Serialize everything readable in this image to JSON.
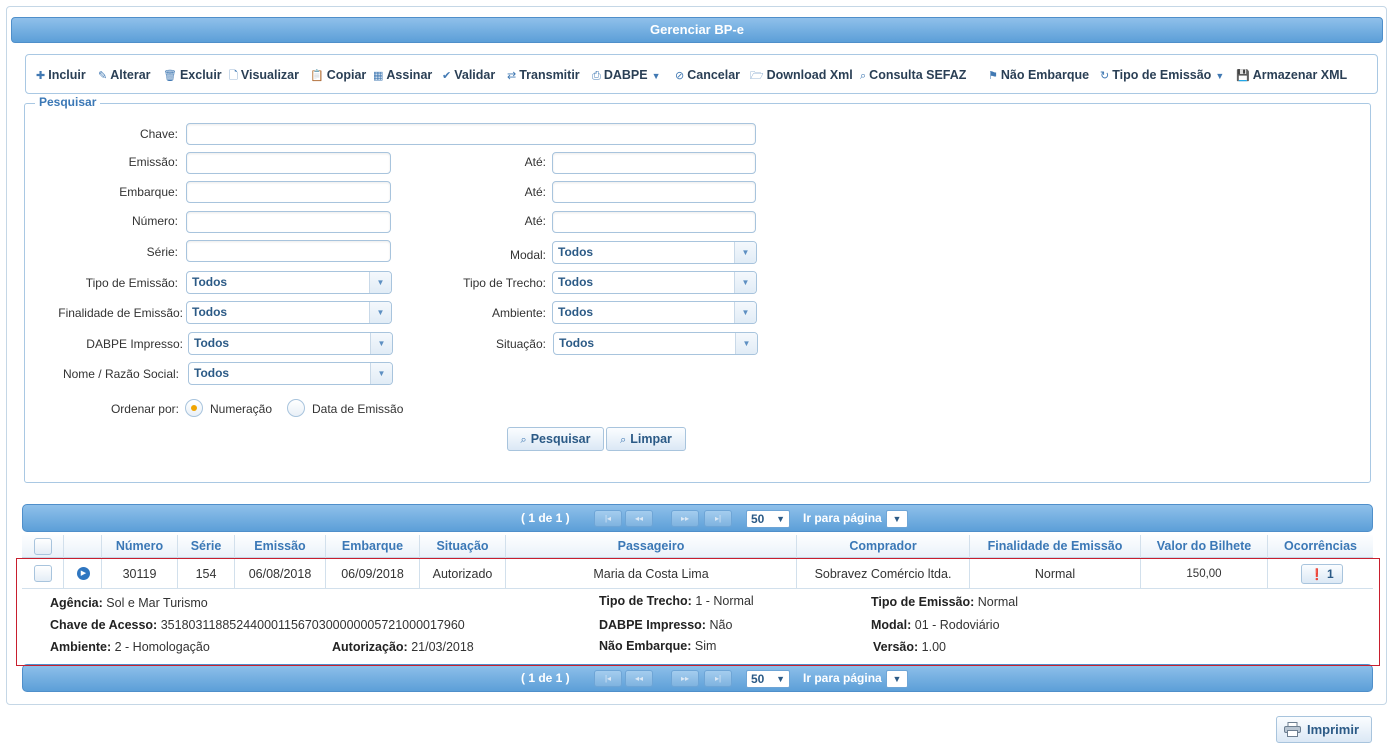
{
  "title": "Gerenciar BP-e",
  "toolbar": {
    "incluir": "Incluir",
    "alterar": "Alterar",
    "excluir": "Excluir",
    "visualizar": "Visualizar",
    "copiar": "Copiar",
    "assinar": "Assinar",
    "validar": "Validar",
    "transmitir": "Transmitir",
    "dabpe": "DABPE",
    "cancelar": "Cancelar",
    "download_xml": "Download Xml",
    "consulta_sefaz": "Consulta SEFAZ",
    "nao_embarque": "Não Embarque",
    "tipo_emissao": "Tipo de Emissão",
    "armazenar_xml": "Armazenar XML"
  },
  "search": {
    "legend": "Pesquisar",
    "chave": "Chave:",
    "emissao": "Emissão:",
    "embarque": "Embarque:",
    "numero": "Número:",
    "serie": "Série:",
    "ate": "Até:",
    "modal": "Modal:",
    "tipo_emissao": "Tipo de Emissão:",
    "tipo_trecho": "Tipo de Trecho:",
    "finalidade": "Finalidade de Emissão:",
    "ambiente": "Ambiente:",
    "dabpe_impresso": "DABPE Impresso:",
    "situacao": "Situação:",
    "nome": "Nome / Razão Social:",
    "todos": "Todos",
    "ordenar": "Ordenar por:",
    "opt_numeracao": "Numeração",
    "opt_data": "Data de Emissão",
    "btn_pesquisar": "Pesquisar",
    "btn_limpar": "Limpar"
  },
  "pager": {
    "count": "( 1 de 1 )",
    "rows": "50",
    "goto": "Ir para página"
  },
  "grid": {
    "columns": [
      "Número",
      "Série",
      "Emissão",
      "Embarque",
      "Situação",
      "Passageiro",
      "Comprador",
      "Finalidade de Emissão",
      "Valor do Bilhete",
      "Ocorrências"
    ],
    "row": {
      "numero": "30119",
      "serie": "154",
      "emissao": "06/08/2018",
      "embarque": "06/09/2018",
      "situacao": "Autorizado",
      "passageiro": "Maria da Costa Lima",
      "comprador": "Sobravez Comércio ltda.",
      "finalidade": "Normal",
      "valor": "150,00",
      "ocorrencias": "1"
    },
    "detail": {
      "agencia_l": "Agência:",
      "agencia_v": "Sol e Mar Turismo",
      "chave_l": "Chave de Acesso:",
      "chave_v": "35180311885244000115670300000005721000017960",
      "ambiente_l": "Ambiente:",
      "ambiente_v": "2 - Homologação",
      "autorizacao_l": "Autorização:",
      "autorizacao_v": "21/03/2018",
      "tipo_trecho_l": "Tipo de Trecho:",
      "tipo_trecho_v": "1 - Normal",
      "dabpe_l": "DABPE Impresso:",
      "dabpe_v": "Não",
      "nao_emb_l": "Não Embarque:",
      "nao_emb_v": "Sim",
      "tipo_emissao_l": "Tipo de Emissão:",
      "tipo_emissao_v": "Normal",
      "modal_l": "Modal:",
      "modal_v": "01 - Rodoviário",
      "versao_l": "Versão:",
      "versao_v": "1.00"
    }
  },
  "print_label": "Imprimir"
}
